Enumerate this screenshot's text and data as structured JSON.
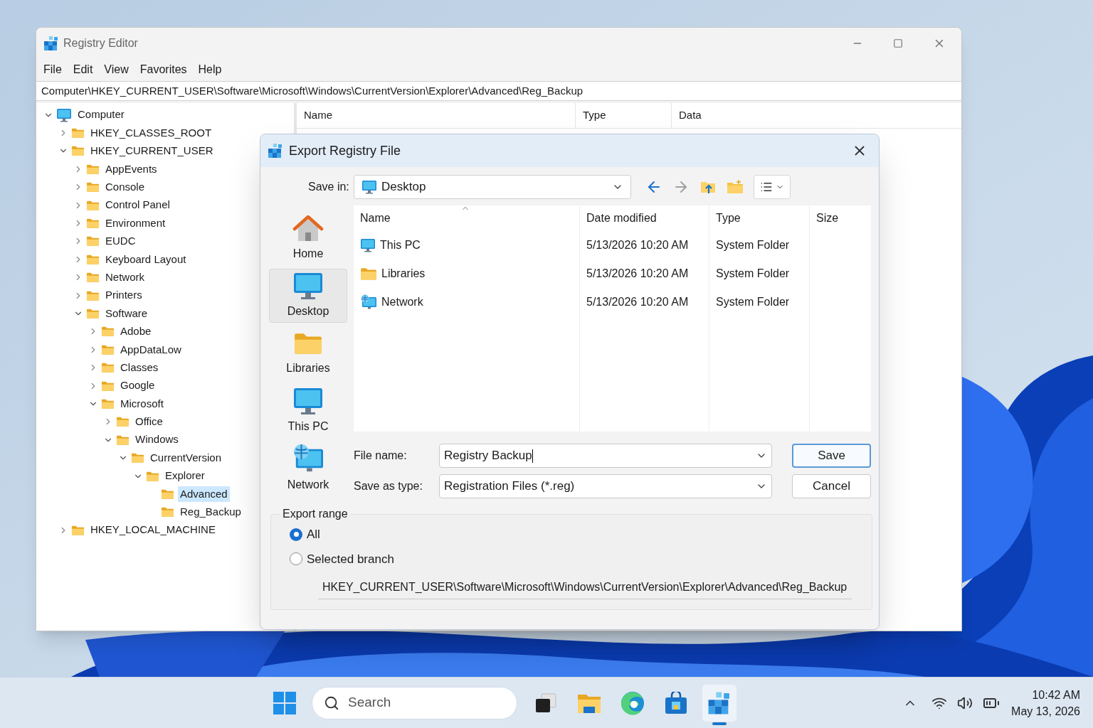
{
  "window": {
    "title": "Registry Editor"
  },
  "menu": [
    "File",
    "Edit",
    "View",
    "Favorites",
    "Help"
  ],
  "address_bar": "Computer\\HKEY_CURRENT_USER\\Software\\Microsoft\\Windows\\CurrentVersion\\Explorer\\Advanced\\Reg_Backup",
  "tree": [
    {
      "label": "Computer",
      "kind": "computer",
      "expanded": true,
      "selected": false,
      "children": [
        {
          "label": "HKEY_CLASSES_ROOT",
          "expanded": false,
          "selected": false
        },
        {
          "label": "HKEY_CURRENT_USER",
          "expanded": true,
          "selected": false,
          "children": [
            {
              "label": "AppEvents",
              "expanded": false,
              "selected": false
            },
            {
              "label": "Console",
              "expanded": false,
              "selected": false
            },
            {
              "label": "Control Panel",
              "expanded": false,
              "selected": false
            },
            {
              "label": "Environment",
              "expanded": false,
              "selected": false
            },
            {
              "label": "EUDC",
              "expanded": false,
              "selected": false
            },
            {
              "label": "Keyboard Layout",
              "expanded": false,
              "selected": false
            },
            {
              "label": "Network",
              "expanded": false,
              "selected": false
            },
            {
              "label": "Printers",
              "expanded": false,
              "selected": false
            },
            {
              "label": "Software",
              "expanded": true,
              "selected": false,
              "children": [
                {
                  "label": "Adobe",
                  "expanded": false,
                  "selected": false
                },
                {
                  "label": "AppDataLow",
                  "expanded": false,
                  "selected": false
                },
                {
                  "label": "Classes",
                  "expanded": false,
                  "selected": false
                },
                {
                  "label": "Google",
                  "expanded": false,
                  "selected": false
                },
                {
                  "label": "Microsoft",
                  "expanded": true,
                  "selected": false,
                  "children": [
                    {
                      "label": "Office",
                      "expanded": false,
                      "selected": false
                    },
                    {
                      "label": "Windows",
                      "expanded": true,
                      "selected": false,
                      "children": [
                        {
                          "label": "CurrentVersion",
                          "expanded": true,
                          "selected": false,
                          "children": [
                            {
                              "label": "Explorer",
                              "expanded": true,
                              "selected": false,
                              "children": [
                                {
                                  "label": "Advanced",
                                  "selected": true
                                },
                                {
                                  "label": "Reg_Backup",
                                  "selected": false
                                }
                              ]
                            }
                          ]
                        }
                      ]
                    }
                  ]
                }
              ]
            }
          ]
        },
        {
          "label": "HKEY_LOCAL_MACHINE",
          "expanded": false,
          "selected": false
        }
      ]
    }
  ],
  "values_table": {
    "columns": [
      "Name",
      "Type",
      "Data"
    ]
  },
  "dialog": {
    "title": "Export Registry File",
    "save_in": {
      "label": "Save in:",
      "value": "Desktop"
    },
    "nav_buttons": [
      {
        "kind": "back",
        "disabled": false
      },
      {
        "kind": "forward",
        "disabled": true
      },
      {
        "kind": "up",
        "disabled": false
      },
      {
        "kind": "new-folder",
        "disabled": false
      },
      {
        "kind": "view",
        "disabled": false
      }
    ],
    "places": [
      {
        "label": "Home",
        "kind": "home",
        "selected": false
      },
      {
        "label": "Desktop",
        "kind": "desktop",
        "selected": true
      },
      {
        "label": "Libraries",
        "kind": "libraries",
        "selected": false
      },
      {
        "label": "This PC",
        "kind": "pc",
        "selected": false
      },
      {
        "label": "Network",
        "kind": "network",
        "selected": false
      }
    ],
    "file_list": {
      "columns": [
        "Name",
        "Date modified",
        "Type",
        "Size"
      ],
      "rows": [
        {
          "kind": "pc",
          "name": "This PC",
          "date": "5/13/2026 10:20 AM",
          "type": "System Folder"
        },
        {
          "kind": "libraries",
          "name": "Libraries",
          "date": "5/13/2026 10:20 AM",
          "type": "System Folder"
        },
        {
          "kind": "network",
          "name": "Network",
          "date": "5/13/2026 10:20 AM",
          "type": "System Folder"
        }
      ]
    },
    "file_name": {
      "label": "File name:",
      "value": "Registry Backup"
    },
    "save_as_type": {
      "label": "Save as type:",
      "value": "Registration Files (*.reg)"
    },
    "buttons": [
      {
        "label": "Save",
        "default": true
      },
      {
        "label": "Cancel",
        "default": false
      }
    ],
    "export_range": {
      "title": "Export range",
      "options": [
        {
          "label": "All",
          "selected": true
        },
        {
          "label": "Selected branch",
          "selected": false
        }
      ],
      "branch_path": "HKEY_CURRENT_USER\\Software\\Microsoft\\Windows\\CurrentVersion\\Explorer\\Advanced\\Reg_Backup"
    }
  },
  "taskbar": {
    "search": {
      "placeholder": "Search"
    },
    "apps": [
      {
        "kind": "task-view",
        "active": false
      },
      {
        "kind": "file-explorer",
        "active": false
      },
      {
        "kind": "browser",
        "active": false
      },
      {
        "kind": "store",
        "active": false
      },
      {
        "kind": "regedit",
        "active": true
      }
    ],
    "clock": {
      "time": "10:42 AM",
      "date": "May 13, 2026"
    }
  }
}
